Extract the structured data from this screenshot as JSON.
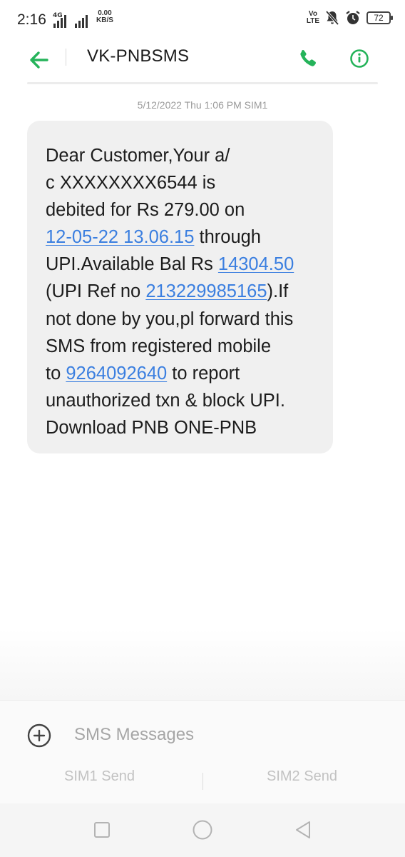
{
  "status_bar": {
    "time": "2:16",
    "net_type": "4G",
    "speed_value": "0.00",
    "speed_unit": "KB/S",
    "volte_top": "Vo",
    "volte_bottom": "LTE",
    "battery": "72",
    "icons": [
      "signal-icon",
      "mute-icon",
      "alarm-icon",
      "battery-icon"
    ]
  },
  "header": {
    "title": "VK-PNBSMS",
    "accent_color": "#25b35a"
  },
  "conversation": {
    "timestamp": "5/12/2022 Thu 1:06 PM  SIM1",
    "message": {
      "line1": "Dear Customer,Your a/",
      "line2": "c XXXXXXXX6544 is",
      "line3": "debited for Rs 279.00 on",
      "date_link": "12-05-22 13.06.15",
      "line4_tail": " through",
      "line5_head": "UPI.Available Bal Rs ",
      "balance_link": "14304.50",
      "line6_head": "(UPI Ref no ",
      "ref_link": "213229985165",
      "line6_tail": ").If",
      "line7": "not done by you,pl forward this",
      "line8": "SMS from registered mobile",
      "line9_head": "to ",
      "phone_link": "9264092640",
      "line9_tail": " to report",
      "line10": "unauthorized txn & block UPI.",
      "line11": "Download PNB ONE-PNB"
    },
    "link_color": "#3b7fe0"
  },
  "composer": {
    "placeholder": "SMS Messages",
    "value": "",
    "sim1_label": "SIM1 Send",
    "sim2_label": "SIM2 Send"
  }
}
